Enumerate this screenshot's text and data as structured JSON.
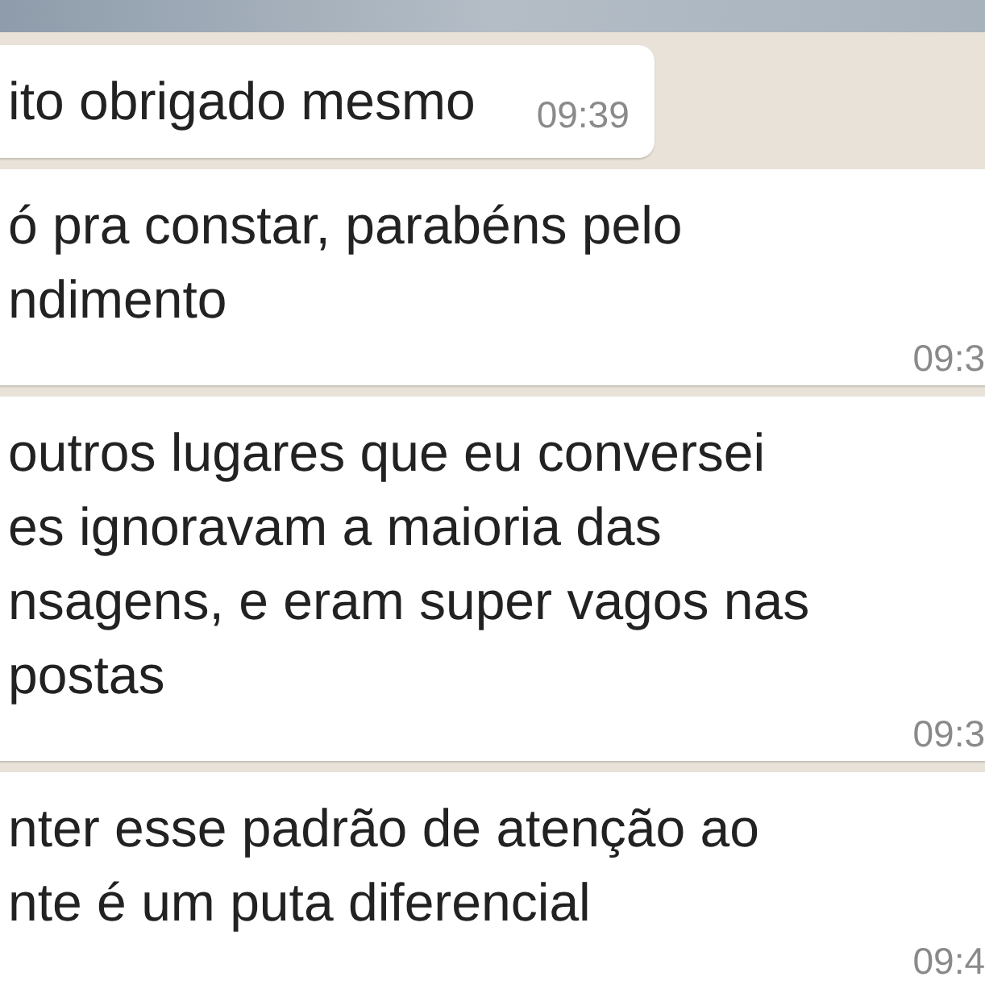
{
  "messages": [
    {
      "kind": "short",
      "text": "ito obrigado mesmo",
      "time": "09:39"
    },
    {
      "kind": "long",
      "text": "ó pra constar, parabéns pelo\nndimento",
      "time": "09:3"
    },
    {
      "kind": "long",
      "text": "outros lugares que eu conversei\nes ignoravam a maioria das\nnsagens, e eram super vagos nas\npostas",
      "time": "09:3"
    },
    {
      "kind": "long",
      "text": "nter esse padrão de atenção ao\nnte é um puta diferencial",
      "time": "09:4"
    }
  ]
}
